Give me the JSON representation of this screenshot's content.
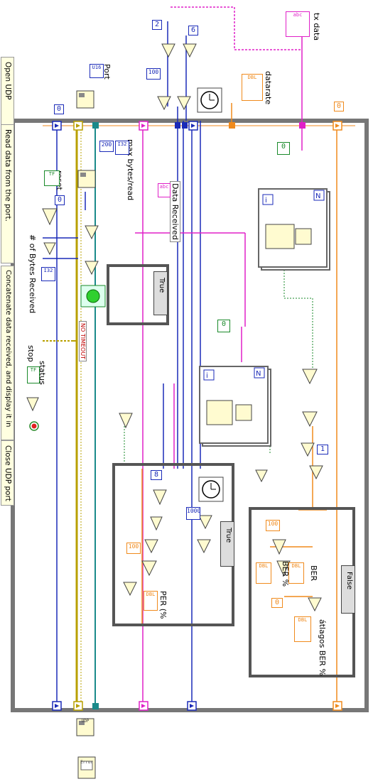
{
  "comments": {
    "open_udp": "Open UDP",
    "read_data": "Read data from the port.",
    "concatenate": "Concatenate data received, and display it in",
    "close_udp": "Close UDP port"
  },
  "labels": {
    "port": "Port",
    "max_bytes": "max bytes/read",
    "data_received": "Data Received",
    "num_bytes": "# of Bytes Received",
    "reset": "reset",
    "stop": "stop",
    "status": "status",
    "datarate": "datarate",
    "tx_data": "tx data",
    "per": "PER (%",
    "ber": "BER",
    "ber_pct": "BER %",
    "atlagos_ber": "átlagos BER %",
    "no_timeout": "NO TIMEOUT"
  },
  "constants": {
    "c_zero_top": "0",
    "c_zero_right": "0",
    "c_two": "2",
    "c_six": "6",
    "c_hundred_top": "100",
    "c_200": "200",
    "c_zero_mid": "0",
    "c_eight": "8",
    "c_1000": "1000",
    "c_hundred_per": "100",
    "c_hundred_ber": "100",
    "c_one": "1",
    "c_zero_shift": "0",
    "c_zero_inner_1": "0",
    "c_zero_inner_2": "0"
  },
  "type_tags": {
    "u16": "U16",
    "i32": "I32",
    "tf": "TF",
    "dbl": "DBL",
    "abc": "abc",
    "i32b": "I32",
    "udp": "UDP",
    "error": "Error"
  },
  "case_selectors": {
    "case_timeout": "True",
    "case_per": "True",
    "case_ber": "False"
  },
  "colors": {
    "wire_blue": "#1a2ab8",
    "wire_pink": "#e020c8",
    "wire_orange": "#f08a1c",
    "wire_green": "#1a8a2a",
    "wire_error": "#b8a000",
    "frame": "#666666"
  }
}
